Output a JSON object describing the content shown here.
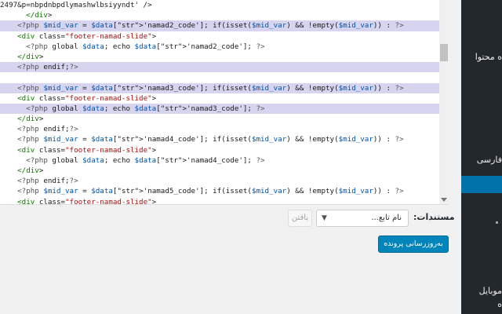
{
  "editor": {
    "lines": [
      {
        "text": "2497&p=nbpdnbpdlymashwlbsiyyndt' />",
        "hl": false,
        "indent": 0
      },
      {
        "text": "</div>",
        "hl": false,
        "indent": 3
      },
      {
        "text": "<?php $mid_var = $data['namad2_code']; if(isset($mid_var) && !empty($mid_var)) : ?>",
        "hl": true,
        "indent": 2
      },
      {
        "text": "<div class=\"footer-namad-slide\">",
        "hl": false,
        "indent": 2
      },
      {
        "text": "<?php global $data; echo $data['namad2_code']; ?>",
        "hl": false,
        "indent": 3
      },
      {
        "text": "</div>",
        "hl": false,
        "indent": 2
      },
      {
        "text": "<?php endif;?>",
        "hl": true,
        "indent": 2
      },
      {
        "text": "",
        "hl": false,
        "indent": 0
      },
      {
        "text": "<?php $mid_var = $data['namad3_code']; if(isset($mid_var) && !empty($mid_var)) : ?>",
        "hl": true,
        "indent": 2
      },
      {
        "text": "<div class=\"footer-namad-slide\">",
        "hl": false,
        "indent": 2
      },
      {
        "text": "<?php global $data; echo $data['namad3_code']; ?>",
        "hl": true,
        "indent": 3
      },
      {
        "text": "</div>",
        "hl": false,
        "indent": 2
      },
      {
        "text": "<?php endif;?>",
        "hl": false,
        "indent": 2
      },
      {
        "text": "<?php $mid_var = $data['namad4_code']; if(isset($mid_var) && !empty($mid_var)) : ?>",
        "hl": false,
        "indent": 2
      },
      {
        "text": "<div class=\"footer-namad-slide\">",
        "hl": false,
        "indent": 2
      },
      {
        "text": "<?php global $data; echo $data['namad4_code']; ?>",
        "hl": false,
        "indent": 3
      },
      {
        "text": "</div>",
        "hl": false,
        "indent": 2
      },
      {
        "text": "<?php endif;?>",
        "hl": false,
        "indent": 2
      },
      {
        "text": "<?php $mid_var = $data['namad5_code']; if(isset($mid_var) && !empty($mid_var)) : ?>",
        "hl": false,
        "indent": 2
      },
      {
        "text": "<div class=\"footer-namad-slide\">",
        "hl": false,
        "indent": 2
      }
    ]
  },
  "sidebar": {
    "items": [
      "ه محتوا",
      "فارسی",
      "موبایل",
      "ه"
    ]
  },
  "documentation": {
    "label": "مستندات:",
    "select_value": "نام تابع...",
    "lookup_label": "یافتن"
  },
  "update_button_label": "به‌روزرسانی پرونده",
  "colors": {
    "highlight": "#d7d4f0",
    "sidebar_bg": "#23282d",
    "primary": "#0085ba"
  }
}
